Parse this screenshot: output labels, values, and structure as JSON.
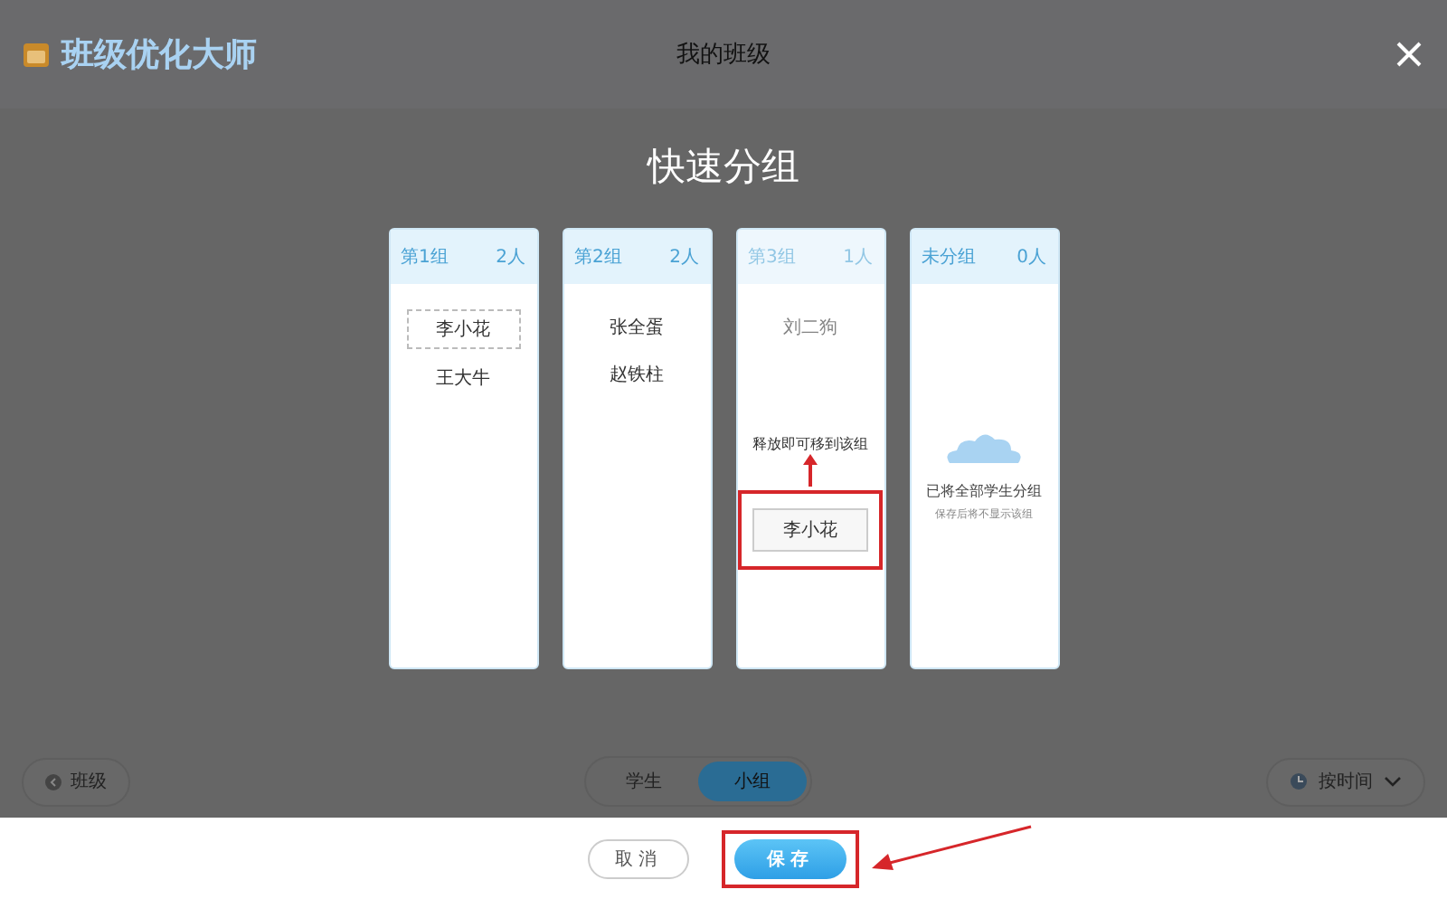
{
  "app": {
    "name": "班级优化大师"
  },
  "window": {
    "title": "我的班级"
  },
  "dialog_title": "快速分组",
  "groups": [
    {
      "name": "第1组",
      "count": "2人",
      "drop_target": false,
      "members": [
        {
          "name": "李小花",
          "kind": "placeholder"
        },
        {
          "name": "王大牛",
          "kind": "normal"
        }
      ]
    },
    {
      "name": "第2组",
      "count": "2人",
      "drop_target": false,
      "members": [
        {
          "name": "张全蛋",
          "kind": "normal"
        },
        {
          "name": "赵铁柱",
          "kind": "normal"
        }
      ]
    },
    {
      "name": "第3组",
      "count": "1人",
      "drop_target": true,
      "members": [
        {
          "name": "刘二狗",
          "kind": "normal"
        }
      ],
      "drop_hint": "释放即可移到该组",
      "dragged": "李小花"
    },
    {
      "name": "未分组",
      "count": "0人",
      "drop_target": false,
      "empty": {
        "title": "已将全部学生分组",
        "subtitle": "保存后将不显示该组"
      }
    }
  ],
  "bottom_bar": {
    "back_button": "班级",
    "tabs": [
      {
        "label": "学生",
        "selected": false
      },
      {
        "label": "小组",
        "selected": true
      }
    ],
    "sort": "按时间"
  },
  "actions": [
    {
      "label": "取消",
      "kind": "secondary",
      "highlighted": false
    },
    {
      "label": "保存",
      "kind": "primary",
      "highlighted": true
    }
  ]
}
